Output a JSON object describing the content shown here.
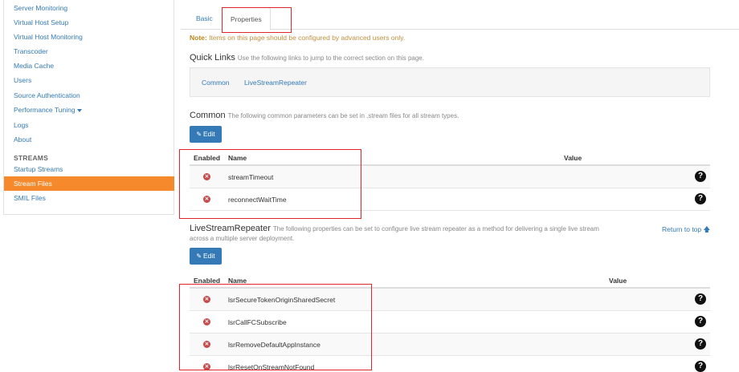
{
  "sidebar": {
    "items_top": [
      "Server Monitoring",
      "Virtual Host Setup",
      "Virtual Host Monitoring",
      "Transcoder",
      "Media Cache",
      "Users",
      "Source Authentication",
      "Performance Tuning",
      "Logs",
      "About"
    ],
    "streams_header": "STREAMS",
    "items_streams": [
      "Startup Streams",
      "Stream Files",
      "SMIL Files"
    ],
    "active": "Stream Files"
  },
  "tabs": {
    "basic": "Basic",
    "properties": "Properties"
  },
  "note": {
    "label": "Note:",
    "text": "Items on this page should be configured by advanced users only."
  },
  "quick_links": {
    "title": "Quick Links",
    "desc": "Use the following links to jump to the correct section on this page.",
    "links": [
      "Common",
      "LiveStreamRepeater"
    ]
  },
  "common": {
    "title": "Common",
    "desc": "The following common parameters can be set in .stream files for all stream types.",
    "edit_label": "Edit",
    "headers": {
      "enabled": "Enabled",
      "name": "Name",
      "value": "Value"
    },
    "rows": [
      "streamTimeout",
      "reconnectWaitTime"
    ]
  },
  "lsr": {
    "title": "LiveStreamRepeater",
    "desc": "The following properties can be set to configure live stream repeater as a method for delivering a single live stream",
    "desc2": "across a multiple server deployment.",
    "return_top": "Return to top",
    "edit_label": "Edit",
    "headers": {
      "enabled": "Enabled",
      "name": "Name",
      "value": "Value"
    },
    "rows": [
      "lsrSecureTokenOriginSharedSecret",
      "lsrCallFCSubscribe",
      "lsrRemoveDefaultAppInstance",
      "lsrResetOnStreamNotFound"
    ]
  },
  "icons": {
    "disabled": "x-circle-icon",
    "help": "question-circle-icon",
    "edit": "pencil-icon",
    "return": "arrow-up-icon"
  },
  "colors": {
    "accent": "#337ab7",
    "active_nav": "#f6892c",
    "annotation": "#e0262b",
    "disabled_icon": "#c7494a"
  }
}
